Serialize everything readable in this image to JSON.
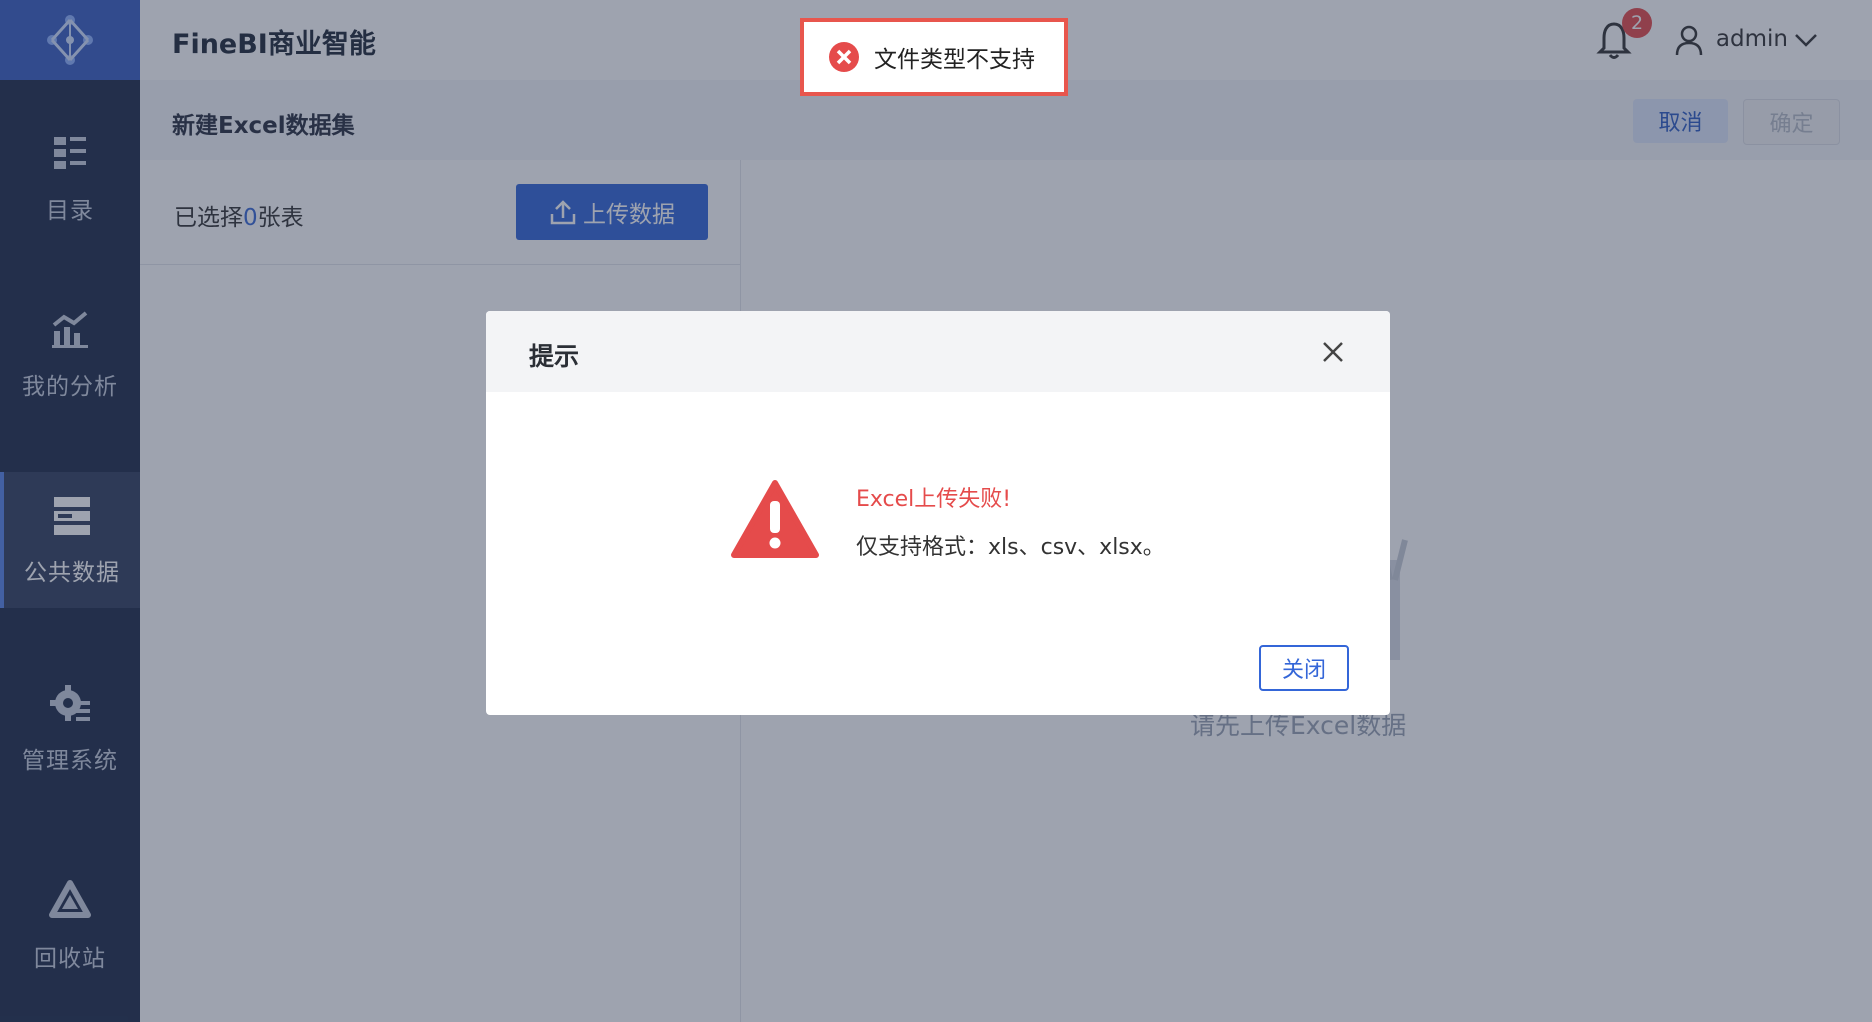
{
  "app": {
    "title": "FineBI商业智能"
  },
  "sidebar": {
    "items": [
      {
        "label": "目录",
        "icon": "catalog-icon"
      },
      {
        "label": "我的分析",
        "icon": "analysis-chart-icon"
      },
      {
        "label": "公共数据",
        "icon": "public-data-icon",
        "active": true
      },
      {
        "label": "管理系统",
        "icon": "gear-icon"
      },
      {
        "label": "回收站",
        "icon": "recycle-bin-icon"
      }
    ]
  },
  "header": {
    "notification_count": "2",
    "user_name": "admin"
  },
  "subheader": {
    "title": "新建Excel数据集",
    "cancel_label": "取消",
    "confirm_label": "确定"
  },
  "left_panel": {
    "selected_prefix": "已选择",
    "selected_count": "0",
    "selected_suffix": "张表",
    "upload_label": "上传数据"
  },
  "empty_state": {
    "text": "请先上传Excel数据"
  },
  "toast": {
    "text": "文件类型不支持"
  },
  "dialog": {
    "title": "提示",
    "error_title": "Excel上传失败!",
    "error_detail": "仅支持格式：xls、csv、xlsx。",
    "close_label": "关闭"
  },
  "colors": {
    "sidebar_bg": "#1f2c4a",
    "accent": "#3466d8",
    "error": "#e54b4b"
  }
}
